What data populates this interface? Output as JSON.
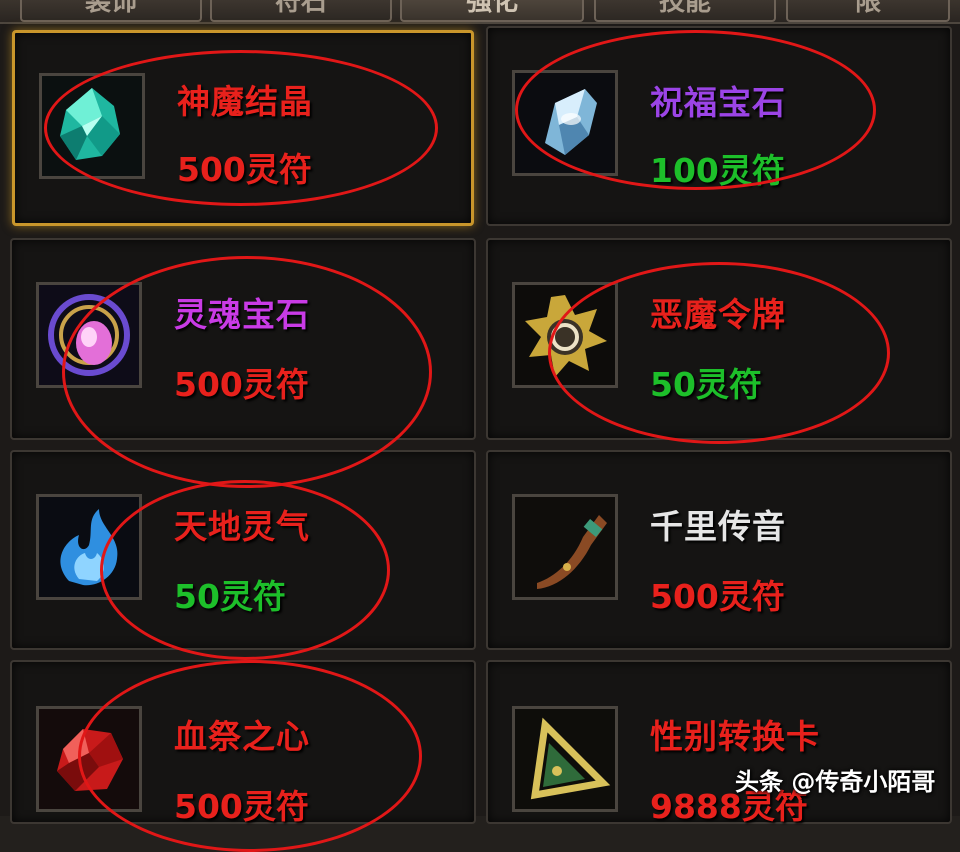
{
  "tabs": [
    "装饰",
    "符石",
    "强化",
    "技能",
    "限"
  ],
  "items": [
    {
      "name": "神魔结晶",
      "name_color": "#e8211c",
      "price": "500灵符",
      "price_color": "#e8211c",
      "icon": "cyan-crystal-icon",
      "selected": true
    },
    {
      "name": "祝福宝石",
      "name_color": "#9b44e6",
      "price": "100灵符",
      "price_color": "#1dbf2a",
      "icon": "blessing-stone-icon",
      "selected": false
    },
    {
      "name": "灵魂宝石",
      "name_color": "#c93be6",
      "price": "500灵符",
      "price_color": "#e8211c",
      "icon": "soul-gem-icon",
      "selected": false
    },
    {
      "name": "恶魔令牌",
      "name_color": "#e8211c",
      "price": "50灵符",
      "price_color": "#1dbf2a",
      "icon": "demon-token-icon",
      "selected": false
    },
    {
      "name": "天地灵气",
      "name_color": "#e8211c",
      "price": "50灵符",
      "price_color": "#1dbf2a",
      "icon": "blue-flame-icon",
      "selected": false
    },
    {
      "name": "千里传音",
      "name_color": "#e6e6e6",
      "price": "500灵符",
      "price_color": "#e8211c",
      "icon": "horn-icon",
      "selected": false
    },
    {
      "name": "血祭之心",
      "name_color": "#e8211c",
      "price": "500灵符",
      "price_color": "#e8211c",
      "icon": "blood-heart-gem-icon",
      "selected": false
    },
    {
      "name": "性别转换卡",
      "name_color": "#e8211c",
      "price": "9888灵符",
      "price_color": "#e8211c",
      "icon": "triangle-card-icon",
      "selected": false
    }
  ],
  "watermark": "头条 @传奇小陌哥",
  "annotation_color": "#e11717"
}
